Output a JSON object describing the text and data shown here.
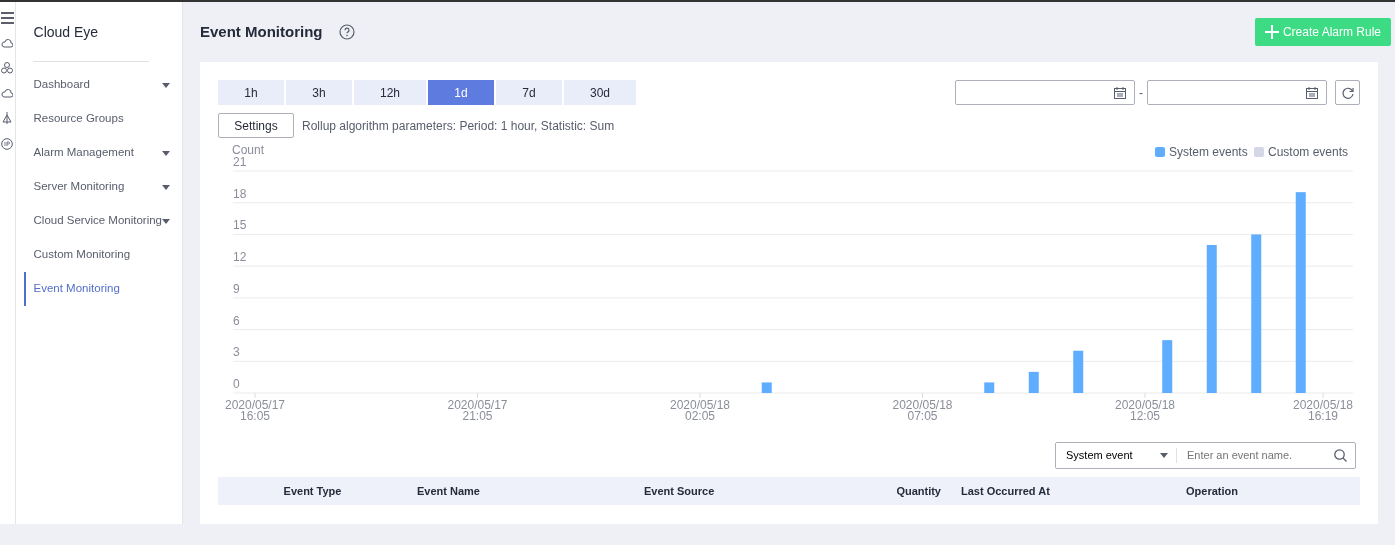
{
  "sidebar": {
    "title": "Cloud Eye",
    "items": [
      {
        "label": "Dashboard",
        "expandable": true,
        "selected": false
      },
      {
        "label": "Resource Groups",
        "expandable": false,
        "selected": false
      },
      {
        "label": "Alarm Management",
        "expandable": true,
        "selected": false
      },
      {
        "label": "Server Monitoring",
        "expandable": true,
        "selected": false
      },
      {
        "label": "Cloud Service Monitoring",
        "expandable": true,
        "selected": false
      },
      {
        "label": "Custom Monitoring",
        "expandable": false,
        "selected": false
      },
      {
        "label": "Event Monitoring",
        "expandable": false,
        "selected": true
      }
    ]
  },
  "header": {
    "title": "Event Monitoring",
    "create_button": "Create Alarm Rule"
  },
  "time_ranges": [
    {
      "label": "1h",
      "selected": false
    },
    {
      "label": "3h",
      "selected": false
    },
    {
      "label": "12h",
      "selected": false
    },
    {
      "label": "1d",
      "selected": true
    },
    {
      "label": "7d",
      "selected": false
    },
    {
      "label": "30d",
      "selected": false
    }
  ],
  "date_separator": "-",
  "settings_button": "Settings",
  "rollup_text": "Rollup algorithm parameters: Period: 1 hour, Statistic: Sum",
  "chart": {
    "chart_data": {
      "type": "bar",
      "ylabel": "Count",
      "grid": true,
      "categories": [
        "2020/05/17 16:05",
        null,
        null,
        null,
        null,
        null,
        null,
        null,
        null,
        null,
        "2020/05/17 21:05",
        null,
        null,
        null,
        null,
        null,
        null,
        null,
        null,
        null,
        "2020/05/18 02:05",
        null,
        null,
        null,
        null,
        null,
        null,
        null,
        null,
        null,
        "2020/05/18 07:05",
        null,
        null,
        null,
        null,
        null,
        null,
        null,
        null,
        null,
        "2020/05/18 12:05",
        null,
        null,
        null,
        null,
        null,
        null,
        null,
        "2020/05/18 16:19"
      ],
      "series": [
        {
          "name": "System events",
          "color": "#5fadff",
          "values": [
            null,
            null,
            null,
            null,
            null,
            null,
            null,
            null,
            null,
            null,
            null,
            null,
            null,
            null,
            null,
            null,
            null,
            null,
            null,
            null,
            null,
            null,
            null,
            1,
            null,
            null,
            null,
            null,
            null,
            null,
            null,
            null,
            null,
            1,
            null,
            2,
            null,
            4,
            null,
            null,
            null,
            5,
            null,
            14,
            null,
            15,
            null,
            19,
            null
          ]
        },
        {
          "name": "Custom events",
          "color": "#d3d7e8",
          "values": [
            null,
            null,
            null,
            null,
            null,
            null,
            null,
            null,
            null,
            null,
            null,
            null,
            null,
            null,
            null,
            null,
            null,
            null,
            null,
            null,
            null,
            null,
            null,
            null,
            null,
            null,
            null,
            null,
            null,
            null,
            null,
            null,
            null,
            null,
            null,
            null,
            null,
            null,
            null,
            null,
            null,
            null,
            null,
            null,
            null,
            null,
            null,
            null,
            null
          ]
        }
      ],
      "ylim": [
        0,
        21
      ],
      "yticks": [
        0,
        3,
        6,
        9,
        12,
        15,
        18,
        21
      ]
    }
  },
  "filter": {
    "type_select": "System event",
    "search_placeholder": "Enter an event name."
  },
  "table": {
    "columns": [
      "Event Type",
      "Event Name",
      "Event Source",
      "Quantity",
      "Last Occurred At",
      "Operation"
    ]
  }
}
